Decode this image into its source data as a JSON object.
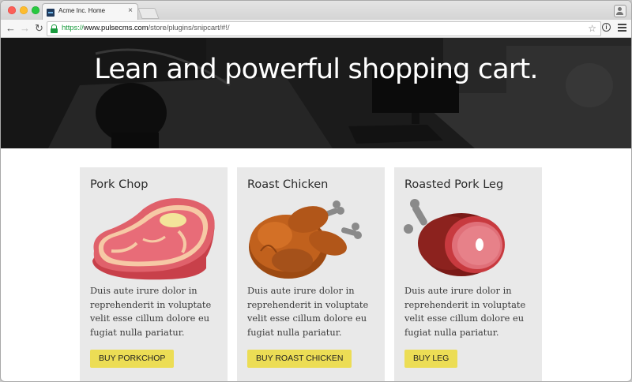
{
  "browser": {
    "tab_title": "Acme Inc. Home",
    "tab_close": "×",
    "url_scheme": "https://",
    "url_host": "www.pulsecms.com",
    "url_path": "/store/plugins/snipcart/#!/",
    "icons": [
      "back-icon",
      "forward-icon",
      "reload-icon",
      "lock-icon",
      "bookmark-star-icon",
      "info-icon",
      "menu-icon",
      "profile-icon"
    ]
  },
  "hero": {
    "title": "Lean and powerful shopping cart."
  },
  "products": [
    {
      "name": "Pork Chop",
      "description": "Duis aute irure dolor in reprehenderit in voluptate velit esse cillum dolore eu fugiat nulla pariatur.",
      "button": "BUY PORKCHOP",
      "icon": "pork-chop-icon"
    },
    {
      "name": "Roast Chicken",
      "description": "Duis aute irure dolor in reprehenderit in voluptate velit esse cillum dolore eu fugiat nulla pariatur.",
      "button": "BUY ROAST CHICKEN",
      "icon": "roast-chicken-icon"
    },
    {
      "name": "Roasted Pork Leg",
      "description": "Duis aute irure dolor in reprehenderit in voluptate velit esse cillum dolore eu fugiat nulla pariatur.",
      "button": "BUY LEG",
      "icon": "pork-leg-icon"
    }
  ],
  "colors": {
    "button": "#ecdd55",
    "card_bg": "#e9e9e9",
    "secure_green": "#1a9b3e"
  }
}
